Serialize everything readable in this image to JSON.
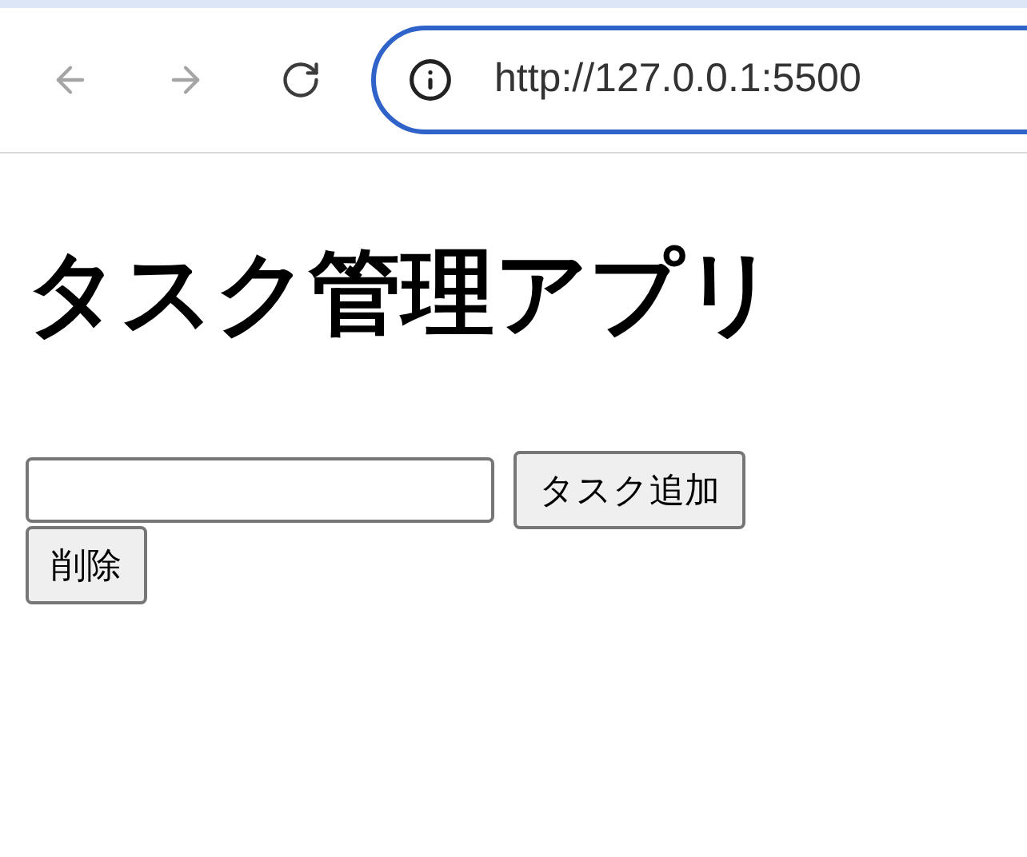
{
  "browser": {
    "nav": [
      {
        "kind": "back",
        "disabled": true
      },
      {
        "kind": "forward",
        "disabled": true
      },
      {
        "kind": "reload",
        "disabled": false
      }
    ],
    "address": {
      "value": "http://127.0.0.1:5500",
      "focused": true
    }
  },
  "page": {
    "heading": "タスク管理アプリ",
    "add_button": "タスク追加",
    "delete_button": "削除"
  }
}
